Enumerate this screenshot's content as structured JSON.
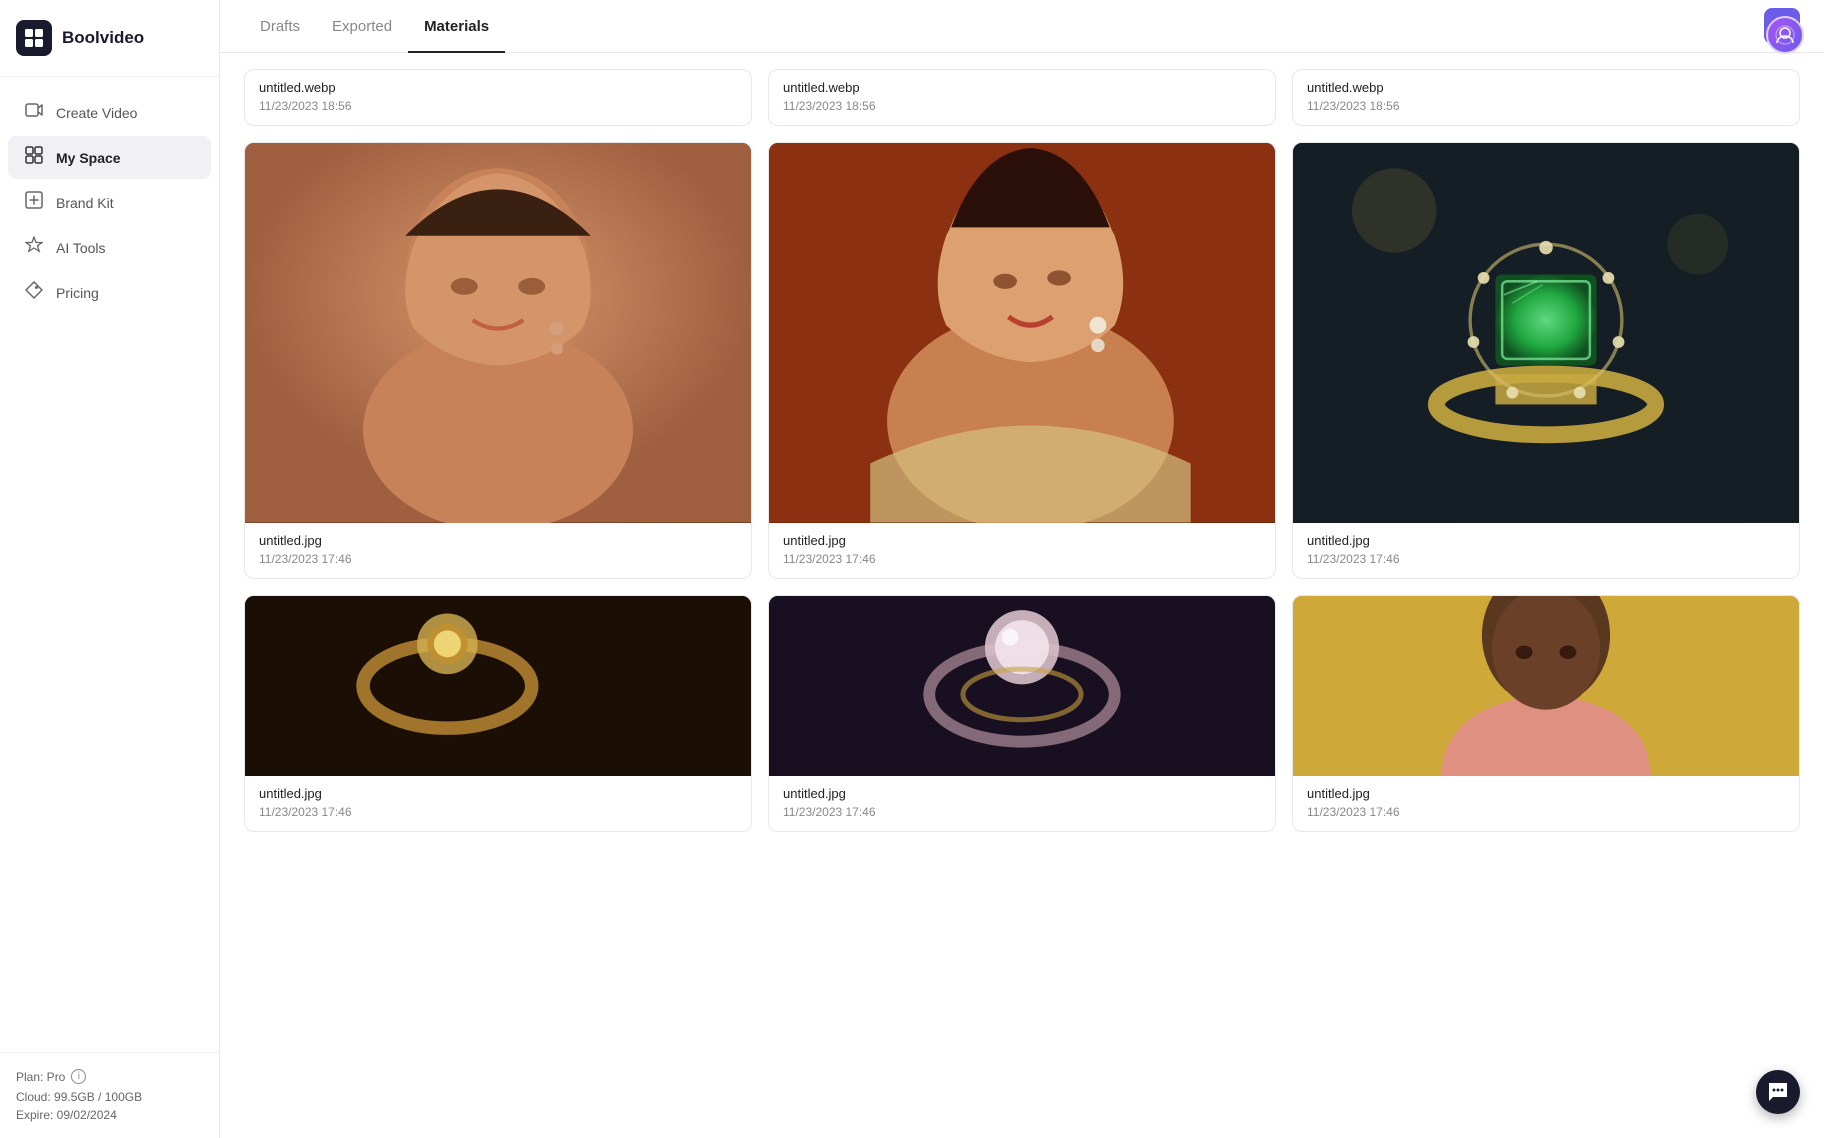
{
  "app": {
    "name": "Boolvideo",
    "logo_char": "▣"
  },
  "sidebar": {
    "items": [
      {
        "id": "create-video",
        "label": "Create Video",
        "icon": "🎬",
        "active": false
      },
      {
        "id": "my-space",
        "label": "My Space",
        "icon": "⊞",
        "active": true
      },
      {
        "id": "brand-kit",
        "label": "Brand Kit",
        "icon": "🖼",
        "active": false
      },
      {
        "id": "ai-tools",
        "label": "AI Tools",
        "icon": "✳",
        "active": false
      },
      {
        "id": "pricing",
        "label": "Pricing",
        "icon": "◇",
        "active": false
      }
    ],
    "footer": {
      "plan_label": "Plan: Pro",
      "cloud_label": "Cloud: 99.5GB / 100GB",
      "expire_label": "Expire: 09/02/2024"
    }
  },
  "tabs": [
    {
      "id": "drafts",
      "label": "Drafts",
      "active": false
    },
    {
      "id": "exported",
      "label": "Exported",
      "active": false
    },
    {
      "id": "materials",
      "label": "Materials",
      "active": true
    }
  ],
  "filter_icon": "⚡",
  "top_row": [
    {
      "name": "untitled.webp",
      "date": "11/23/2023 18:56"
    },
    {
      "name": "untitled.webp",
      "date": "11/23/2023 18:56"
    },
    {
      "name": "untitled.webp",
      "date": "11/23/2023 18:56"
    }
  ],
  "cards_row1": [
    {
      "name": "untitled.jpg",
      "date": "11/23/2023 17:46",
      "bg": "linear-gradient(160deg, #8B5E3C 0%, #3a2010 50%, #5c3020 100%)",
      "image_type": "woman_portrait_warm"
    },
    {
      "name": "untitled.jpg",
      "date": "11/23/2023 17:46",
      "bg": "linear-gradient(160deg, #c0622a 0%, #8B3010 40%, #6a2008 100%)",
      "image_type": "woman_portrait_orange"
    },
    {
      "name": "untitled.jpg",
      "date": "11/23/2023 17:46",
      "bg": "linear-gradient(160deg, #1a2a3a 0%, #0d1520 40%, #2a3a2a 100%)",
      "image_type": "ring_emerald"
    }
  ],
  "cards_row2": [
    {
      "name": "untitled.jpg",
      "date": "11/23/2023 17:46",
      "bg": "linear-gradient(160deg, #2a1a0a 0%, #5a3010 60%, #8B4020 100%)",
      "image_type": "jewelry_dark"
    },
    {
      "name": "untitled.jpg",
      "date": "11/23/2023 17:46",
      "bg": "linear-gradient(160deg, #1a1a2a 0%, #2a2a3a 60%, #3a3040 100%)",
      "image_type": "jewelry_pearl"
    },
    {
      "name": "untitled.jpg",
      "date": "11/23/2023 17:46",
      "bg": "linear-gradient(160deg, #d4a050 0%, #c08030 40%, #8a5010 100%)",
      "image_type": "man_portrait_yellow"
    }
  ]
}
